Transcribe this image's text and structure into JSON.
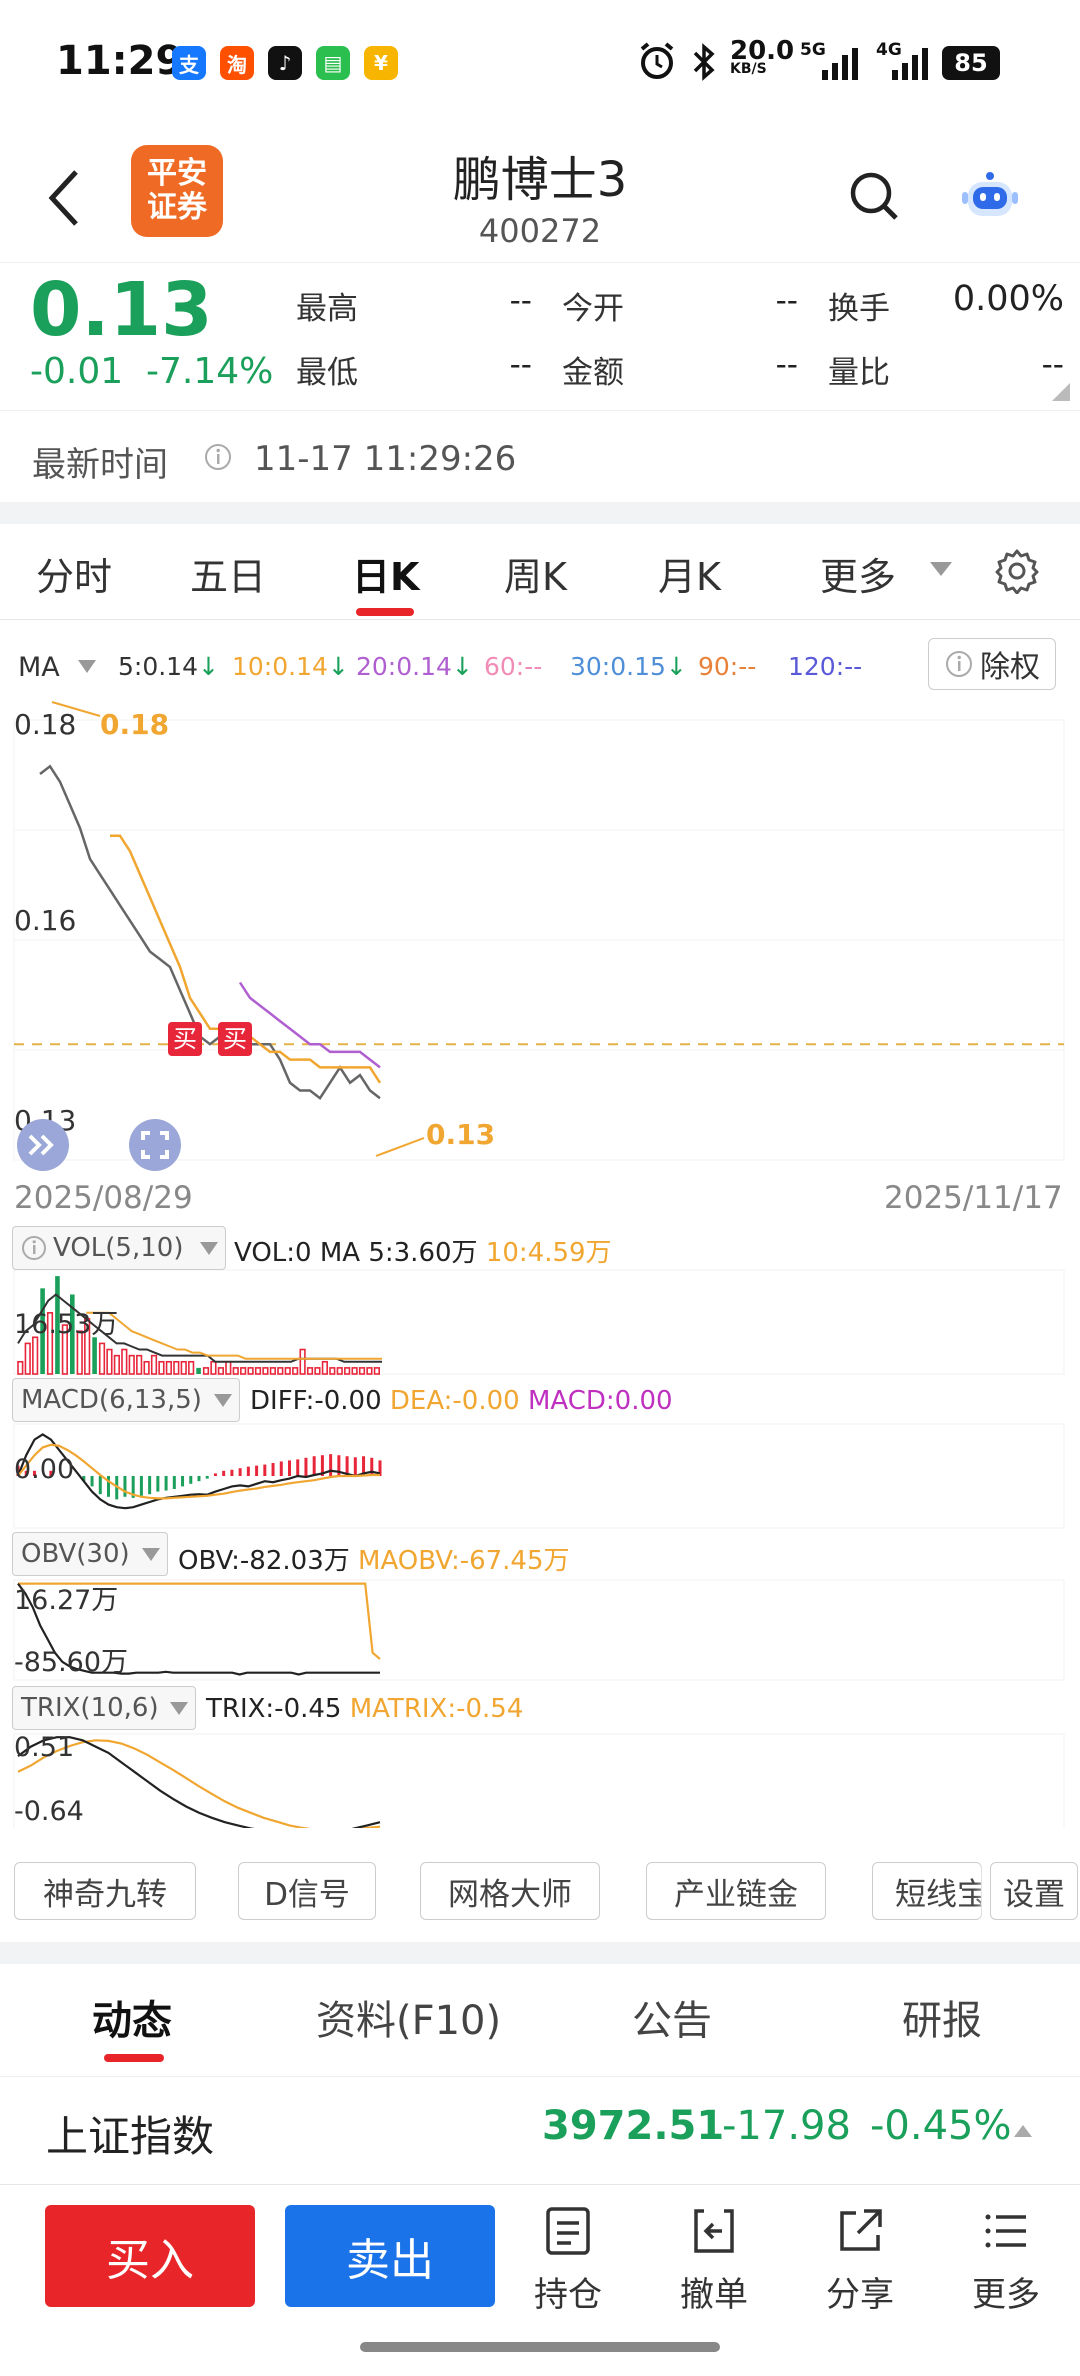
{
  "status_bar": {
    "time": "11:29",
    "app_icons": [
      {
        "name": "alipay-icon",
        "glyph": "支",
        "color": "#1677ff"
      },
      {
        "name": "taobao-icon",
        "glyph": "淘",
        "color": "#ff5000"
      },
      {
        "name": "tiktok-icon",
        "glyph": "♪",
        "color": "#111111"
      },
      {
        "name": "messages-icon",
        "glyph": "▤",
        "color": "#2bbf4f"
      },
      {
        "name": "mini-app-icon",
        "glyph": "¥",
        "color": "#f7b500"
      }
    ],
    "net_speed": "20.0",
    "net_unit": "KB/S",
    "sig1": "5G",
    "sig2": "4G",
    "battery": "85"
  },
  "header": {
    "logo_line1": "平安",
    "logo_line2": "证券",
    "stock_name": "鹏博士3",
    "stock_code": "400272"
  },
  "quote": {
    "price": "0.13",
    "change": "-0.01",
    "change_pct": "-7.14%",
    "stats": [
      {
        "label": "最高",
        "value": "--"
      },
      {
        "label": "今开",
        "value": "--"
      },
      {
        "label": "换手",
        "value": "0.00%"
      },
      {
        "label": "最低",
        "value": "--"
      },
      {
        "label": "金额",
        "value": "--"
      },
      {
        "label": "量比",
        "value": "--"
      }
    ],
    "update_label": "最新时间",
    "update_time": "11-17 11:29:26"
  },
  "period_tabs": [
    "分时",
    "五日",
    "日K",
    "周K",
    "月K",
    "更多"
  ],
  "active_period": "日K",
  "ma_bar": {
    "label": "MA",
    "items": [
      {
        "text": "5:0.14",
        "arrow": "↓",
        "color": "#333333"
      },
      {
        "text": "10:0.14",
        "arrow": "↓",
        "color": "#f0a630"
      },
      {
        "text": "20:0.14",
        "arrow": "↓",
        "color": "#b05fd0"
      },
      {
        "text": "60:--",
        "arrow": "",
        "color": "#f08cb6"
      },
      {
        "text": "30:0.15",
        "arrow": "↓",
        "color": "#4f8fd8"
      },
      {
        "text": "90:--",
        "arrow": "",
        "color": "#e8813a"
      },
      {
        "text": "120:--",
        "arrow": "",
        "color": "#5a5ad8"
      }
    ],
    "ex_rights": "除权"
  },
  "chart_data": [
    {
      "type": "line",
      "name": "daily-k",
      "y_labels": [
        "0.18",
        "0.16",
        "0.13"
      ],
      "max_label": "0.18",
      "last_label": "0.13",
      "x_start": "2025/08/29",
      "x_end": "2025/11/17",
      "buy_marker": "买",
      "ref_line": 0.14,
      "ylim": [
        0.125,
        0.182
      ],
      "series": [
        {
          "color": "#666666",
          "values": [
            0.175,
            0.176,
            0.174,
            0.171,
            0.168,
            0.164,
            0.162,
            0.16,
            0.158,
            0.156,
            0.154,
            0.152,
            0.151,
            0.15,
            0.147,
            0.144,
            0.141,
            0.14,
            0.141,
            0.14,
            0.14,
            0.14,
            0.14,
            0.14,
            0.138,
            0.135,
            0.134,
            0.134,
            0.133,
            0.135,
            0.137,
            0.135,
            0.136,
            0.134,
            0.133
          ]
        },
        {
          "color": "#f0a630",
          "values": [
            null,
            null,
            null,
            null,
            null,
            null,
            null,
            0.167,
            0.167,
            0.165,
            0.162,
            0.159,
            0.156,
            0.153,
            0.15,
            0.146,
            0.144,
            0.142,
            0.142,
            0.142,
            0.141,
            0.141,
            0.14,
            0.139,
            0.139,
            0.138,
            0.138,
            0.138,
            0.137,
            0.137,
            0.137,
            0.137,
            0.137,
            0.137,
            0.135
          ]
        },
        {
          "color": "#b05fd0",
          "values": [
            null,
            null,
            null,
            null,
            null,
            null,
            null,
            null,
            null,
            null,
            null,
            null,
            null,
            null,
            null,
            null,
            null,
            null,
            null,
            null,
            0.148,
            0.146,
            0.145,
            0.144,
            0.143,
            0.142,
            0.141,
            0.14,
            0.14,
            0.139,
            0.139,
            0.139,
            0.139,
            0.138,
            0.137
          ]
        }
      ]
    },
    {
      "type": "bar",
      "name": "VOL",
      "label": "VOL(5,10)",
      "values_text": [
        {
          "text": "VOL:0",
          "color": "#222222"
        },
        {
          "text": "MA 5:3.60万",
          "color": "#222222"
        },
        {
          "text": "10:4.59万",
          "color": "#f0a630"
        }
      ],
      "y_label": "16.53万",
      "ylim": [
        0,
        17
      ],
      "values": [
        2,
        5,
        6,
        14,
        10,
        16,
        8,
        13,
        7,
        9,
        6,
        5,
        4,
        3,
        4,
        3,
        3,
        2,
        3,
        2,
        2,
        2,
        2,
        2,
        1,
        1,
        2,
        1,
        2,
        1,
        1,
        1,
        1,
        1,
        1,
        1,
        1,
        1,
        4,
        1,
        1,
        2,
        1,
        1,
        1,
        1,
        1,
        1,
        1
      ],
      "up": [
        1,
        1,
        1,
        0,
        1,
        0,
        1,
        0,
        1,
        1,
        0,
        1,
        1,
        1,
        1,
        1,
        1,
        1,
        1,
        1,
        1,
        1,
        1,
        1,
        0,
        1,
        1,
        1,
        1,
        1,
        1,
        1,
        1,
        1,
        1,
        1,
        1,
        1,
        1,
        1,
        1,
        1,
        1,
        1,
        1,
        1,
        1,
        1,
        1
      ],
      "ma5": [
        5,
        7,
        8,
        10,
        12,
        13,
        12,
        11,
        10,
        9,
        8,
        7,
        6,
        5,
        5,
        4.5,
        4,
        4,
        3.5,
        3,
        3,
        3,
        3,
        3,
        3,
        3,
        2,
        2,
        2,
        2,
        2,
        2,
        2,
        2,
        2,
        2,
        2,
        2.5,
        2.5,
        2.5,
        2.5,
        2.5,
        2.5,
        2,
        2,
        2,
        2,
        2,
        2
      ],
      "ma10": [
        null,
        null,
        null,
        null,
        null,
        null,
        null,
        null,
        null,
        10,
        10,
        10,
        10,
        9,
        8,
        7,
        6.5,
        6,
        5.5,
        5,
        4.5,
        4,
        4,
        3.5,
        3.5,
        3,
        3,
        3,
        3,
        3,
        2.5,
        2.5,
        2.5,
        2.5,
        2.5,
        2.5,
        2.5,
        2.5,
        2.5,
        2.5,
        2.5,
        2.5,
        2.5,
        2.5,
        2.5,
        2.5,
        2.5,
        2.5,
        2.5
      ]
    },
    {
      "type": "bar",
      "name": "MACD",
      "label": "MACD(6,13,5)",
      "values_text": [
        {
          "text": "DIFF:-0.00",
          "color": "#222222"
        },
        {
          "text": "DEA:-0.00",
          "color": "#f0a630"
        },
        {
          "text": "MACD:0.00",
          "color": "#c030c0"
        }
      ],
      "y_label": "0.00",
      "ylim": [
        -1,
        1
      ],
      "values": [
        0.2,
        0.1,
        0.1,
        0.0,
        0.1,
        0,
        0,
        0,
        -0.1,
        -0.2,
        -0.35,
        -0.4,
        -0.45,
        -0.4,
        -0.42,
        -0.38,
        -0.35,
        -0.3,
        -0.28,
        -0.25,
        -0.2,
        -0.15,
        -0.1,
        -0.05,
        0.05,
        0.1,
        0.12,
        0.15,
        0.18,
        0.2,
        0.22,
        0.25,
        0.28,
        0.3,
        0.32,
        0.35,
        0.38,
        0.4,
        0.42,
        0.4,
        0.38,
        0.36,
        0.38,
        0.35,
        0.3
      ],
      "diff": [
        0.0,
        0.4,
        0.7,
        0.8,
        0.7,
        0.5,
        0.3,
        0.1,
        -0.1,
        -0.3,
        -0.45,
        -0.55,
        -0.6,
        -0.62,
        -0.6,
        -0.55,
        -0.5,
        -0.45,
        -0.42,
        -0.4,
        -0.38,
        -0.36,
        -0.35,
        -0.36,
        -0.3,
        -0.25,
        -0.2,
        -0.18,
        -0.2,
        -0.15,
        -0.1,
        -0.12,
        -0.08,
        -0.05,
        0.0,
        -0.02,
        0.02,
        0.05,
        0.1,
        0.08,
        0.04,
        0.0,
        0.05,
        0.08,
        0.05
      ],
      "dea": [
        0.0,
        0.2,
        0.4,
        0.55,
        0.6,
        0.58,
        0.5,
        0.4,
        0.28,
        0.15,
        0.02,
        -0.1,
        -0.2,
        -0.3,
        -0.36,
        -0.4,
        -0.42,
        -0.43,
        -0.43,
        -0.42,
        -0.41,
        -0.4,
        -0.39,
        -0.38,
        -0.36,
        -0.34,
        -0.31,
        -0.28,
        -0.26,
        -0.24,
        -0.21,
        -0.19,
        -0.17,
        -0.14,
        -0.12,
        -0.1,
        -0.08,
        -0.05,
        -0.02,
        0.0,
        0.0,
        0.0,
        0.01,
        0.02,
        0.02
      ]
    },
    {
      "type": "line",
      "name": "OBV",
      "label": "OBV(30)",
      "values_text": [
        {
          "text": "OBV:-82.03万",
          "color": "#222222"
        },
        {
          "text": "MAOBV:-67.45万",
          "color": "#f0a630"
        }
      ],
      "y_labels": [
        "16.27万",
        "-85.60万"
      ],
      "ylim": [
        -90,
        20
      ],
      "obv": [
        16,
        5,
        -10,
        -30,
        -45,
        -60,
        -70,
        -75,
        -78,
        -80,
        -82,
        -82,
        -82,
        -82,
        -83,
        -83,
        -82,
        -82,
        -82,
        -82,
        -81,
        -82,
        -82,
        -82,
        -82,
        -82,
        -82,
        -82,
        -82,
        -82,
        -84,
        -82,
        -82,
        -82,
        -82,
        -82,
        -82,
        -82,
        -84,
        -82,
        -82,
        -82,
        -82,
        -82,
        -82,
        -82,
        -82,
        -82,
        -82,
        -82
      ],
      "maobv": [
        16,
        16,
        16,
        16,
        16,
        16,
        16,
        16,
        16,
        16,
        16,
        16,
        16,
        16,
        16,
        16,
        16,
        16,
        16,
        16,
        16,
        16,
        16,
        16,
        16,
        16,
        16,
        16,
        16,
        16,
        16,
        16,
        16,
        16,
        16,
        16,
        16,
        16,
        16,
        16,
        16,
        16,
        16,
        16,
        16,
        16,
        16,
        16,
        -60,
        -67
      ]
    },
    {
      "type": "line",
      "name": "TRIX",
      "label": "TRIX(10,6)",
      "values_text": [
        {
          "text": "TRIX:-0.45",
          "color": "#222222"
        },
        {
          "text": "MATRIX:-0.54",
          "color": "#f0a630"
        }
      ],
      "y_labels": [
        "0.51",
        "-0.64"
      ],
      "ylim": [
        -1.0,
        0.65
      ],
      "trix": [
        0.3,
        0.45,
        0.55,
        0.6,
        0.6,
        0.55,
        0.45,
        0.35,
        0.2,
        0.05,
        -0.1,
        -0.25,
        -0.38,
        -0.5,
        -0.6,
        -0.68,
        -0.75,
        -0.8,
        -0.85,
        -0.88,
        -0.9,
        -0.92,
        -0.93,
        -0.93,
        -0.92,
        -0.9,
        -0.85,
        -0.8,
        -0.75
      ],
      "matrix": [
        0.05,
        0.15,
        0.28,
        0.38,
        0.46,
        0.52,
        0.55,
        0.54,
        0.5,
        0.42,
        0.32,
        0.2,
        0.08,
        -0.05,
        -0.18,
        -0.3,
        -0.42,
        -0.52,
        -0.6,
        -0.68,
        -0.74,
        -0.8,
        -0.84,
        -0.87,
        -0.88,
        -0.88,
        -0.86,
        -0.84,
        -0.82
      ]
    }
  ],
  "indicator_pills": [
    "神奇九转",
    "D信号",
    "网格大师",
    "产业链金",
    "短线宝",
    "设置"
  ],
  "content_tabs": [
    "动态",
    "资料(F10)",
    "公告",
    "研报"
  ],
  "active_content_tab": "动态",
  "index_ticker": {
    "name": "上证指数",
    "value": "3972.51",
    "change": "-17.98",
    "change_pct": "-0.45%"
  },
  "actions": {
    "buy": "买入",
    "sell": "卖出",
    "items": [
      {
        "label": "持仓",
        "icon": "holdings-icon"
      },
      {
        "label": "撤单",
        "icon": "cancel-order-icon"
      },
      {
        "label": "分享",
        "icon": "share-icon"
      },
      {
        "label": "更多",
        "icon": "menu-icon"
      }
    ]
  },
  "colors": {
    "down": "#1aa05a",
    "up": "#e8262a",
    "buy_btn": "#e8262a",
    "sell_btn": "#1a73e8",
    "brand": "#ef6a24"
  }
}
